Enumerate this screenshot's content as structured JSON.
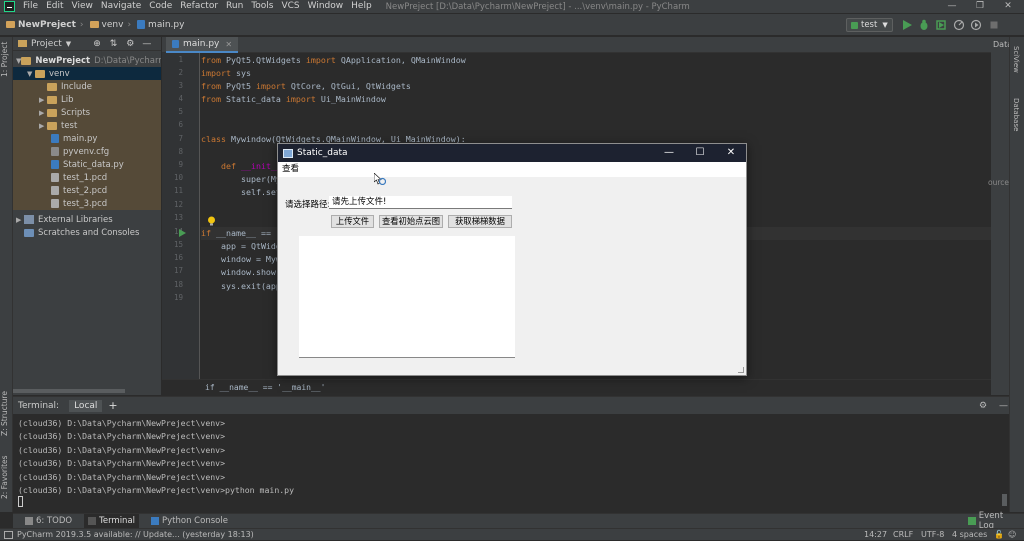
{
  "menubar": {
    "items": [
      "File",
      "Edit",
      "View",
      "Navigate",
      "Code",
      "Refactor",
      "Run",
      "Tools",
      "VCS",
      "Window",
      "Help"
    ],
    "title": "NewPreject [D:\\Data\\Pycharm\\NewPreject] - ...\\venv\\main.py - PyCharm"
  },
  "navbar": {
    "crumbs": [
      "NewPreject",
      "venv",
      "main.py"
    ],
    "run_config": "test"
  },
  "left_strip": {
    "project_tab": "1: Project",
    "structure_tab": "Z: Structure",
    "favorites_tab": "2: Favorites"
  },
  "right_strip": {
    "sciview_tab": "SciView",
    "database_tab": "Database"
  },
  "right_panel": {
    "label": "Data",
    "source_text": "ource"
  },
  "project": {
    "header": "Project",
    "tree": [
      {
        "label": "NewPreject",
        "extra": "D:\\Data\\Pycharm\\NewP"
      },
      {
        "label": "venv"
      },
      {
        "label": "Include"
      },
      {
        "label": "Lib"
      },
      {
        "label": "Scripts"
      },
      {
        "label": "test"
      },
      {
        "label": "main.py"
      },
      {
        "label": "pyvenv.cfg"
      },
      {
        "label": "Static_data.py"
      },
      {
        "label": "test_1.pcd"
      },
      {
        "label": "test_2.pcd"
      },
      {
        "label": "test_3.pcd"
      },
      {
        "label": "External Libraries"
      },
      {
        "label": "Scratches and Consoles"
      }
    ]
  },
  "editor": {
    "tab": "main.py",
    "line_numbers": [
      "1",
      "2",
      "3",
      "4",
      "5",
      "6",
      "7",
      "8",
      "9",
      "10",
      "11",
      "12",
      "13",
      "14",
      "15",
      "16",
      "17",
      "18",
      "19"
    ],
    "lines": [
      {
        "kw1": "from",
        "rest": " PyQt5.QtWidgets ",
        "kw2": "import",
        "tail": " QApplication, QMainWindow"
      },
      {
        "kw1": "import",
        "rest": " sys",
        "kw2": "",
        "tail": ""
      },
      {
        "kw1": "from",
        "rest": " PyQt5 ",
        "kw2": "import",
        "tail": " QtCore, QtGui, QtWidgets"
      },
      {
        "kw1": "from",
        "rest": " Static_data ",
        "kw2": "import",
        "tail": " Ui_MainWindow"
      },
      {
        "kw1": "",
        "rest": "",
        "kw2": "",
        "tail": ""
      },
      {
        "kw1": "",
        "rest": "",
        "kw2": "",
        "tail": ""
      },
      {
        "kw1": "class",
        "rest": " Mywindow(QtWidgets.QMainWindow, Ui_MainWindow):",
        "kw2": "",
        "tail": ""
      },
      {
        "kw1": "",
        "rest": "",
        "kw2": "",
        "tail": ""
      },
      {
        "kw1": "    def",
        "rest": " __init__",
        "kw2": "",
        "tail": ""
      },
      {
        "kw1": "",
        "rest": "        super(My",
        "kw2": "",
        "tail": ""
      },
      {
        "kw1": "",
        "rest": "        self.set",
        "kw2": "",
        "tail": ""
      },
      {
        "kw1": "",
        "rest": "",
        "kw2": "",
        "tail": ""
      },
      {
        "kw1": "",
        "rest": "",
        "kw2": "",
        "tail": ""
      },
      {
        "kw1": "if",
        "rest": " __name__ == '",
        "kw2": "",
        "tail": ""
      },
      {
        "kw1": "",
        "rest": "    app = QtWidg",
        "kw2": "",
        "tail": ""
      },
      {
        "kw1": "",
        "rest": "    window = Myw",
        "kw2": "",
        "tail": ""
      },
      {
        "kw1": "",
        "rest": "    window.show(",
        "kw2": "",
        "tail": ""
      },
      {
        "kw1": "",
        "rest": "    sys.exit(app",
        "kw2": "",
        "tail": ""
      },
      {
        "kw1": "",
        "rest": "",
        "kw2": "",
        "tail": ""
      }
    ],
    "breadcrumb": "if __name__ == '__main__'"
  },
  "terminal": {
    "label": "Terminal:",
    "tab": "Local",
    "add": "+",
    "lines": [
      "(cloud36) D:\\Data\\Pycharm\\NewPreject\\venv>",
      "(cloud36) D:\\Data\\Pycharm\\NewPreject\\venv>",
      "(cloud36) D:\\Data\\Pycharm\\NewPreject\\venv>",
      "(cloud36) D:\\Data\\Pycharm\\NewPreject\\venv>",
      "(cloud36) D:\\Data\\Pycharm\\NewPreject\\venv>",
      "(cloud36) D:\\Data\\Pycharm\\NewPreject\\venv>python main.py"
    ]
  },
  "bottom_toolbar": {
    "todo": "6: TODO",
    "terminal": "Terminal",
    "python_console": "Python Console",
    "event_log": "Event Log"
  },
  "statusbar": {
    "message": "PyCharm 2019.3.5 available: // Update... (yesterday 18:13)",
    "position": "14:27",
    "line_sep": "CRLF",
    "encoding": "UTF-8",
    "indent": "4 spaces"
  },
  "dialog": {
    "title": "Static_data",
    "menu": "查看",
    "path_label": "请选择路径:",
    "path_value": "请先上传文件!",
    "buttons": [
      "上传文件",
      "查看初始点云图",
      "获取梯梯数据"
    ]
  },
  "colors": {
    "accent": "#4a88c7",
    "green_run": "#499c54",
    "dialog_title_bg": "#1d2230"
  }
}
